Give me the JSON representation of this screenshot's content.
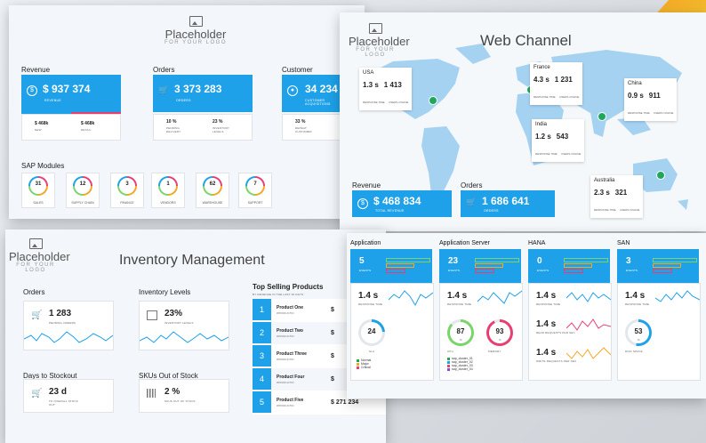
{
  "logo": {
    "name": "Placeholder",
    "sub": "FOR YOUR LOGO"
  },
  "top_left": {
    "sections": {
      "revenue": "Revenue",
      "orders": "Orders",
      "customer": "Customer"
    },
    "revenue": {
      "value": "$ 937 374",
      "caption": "REVENUE",
      "sub1_value": "$ 468k",
      "sub1_label": "NEW",
      "sub2_value": "$ 468k",
      "sub2_label": "RETAIL"
    },
    "orders": {
      "value": "3 373 283",
      "caption": "ORDERS",
      "sub1_value": "10 %",
      "sub1_label": "PENDING DELIVERY",
      "sub2_value": "23 %",
      "sub2_label": "INVENTORY LEVELS"
    },
    "customer": {
      "value": "34 234",
      "caption": "CUSTOMER ACQUISITIONS",
      "sub1_value": "33 %",
      "sub1_label": "REPEAT CUSTOMER"
    },
    "sap_title": "SAP Modules",
    "modules": [
      {
        "value": "31",
        "label": "SALES"
      },
      {
        "value": "12",
        "label": "SUPPLY CHAIN"
      },
      {
        "value": "3",
        "label": "FINANCE"
      },
      {
        "value": "1",
        "label": "VENDORS"
      },
      {
        "value": "62",
        "label": "WAREHOUSE"
      },
      {
        "value": "7",
        "label": "SUPPORT"
      }
    ]
  },
  "web": {
    "title": "Web Channel",
    "response_label": "RESPONSE TIME",
    "users_label": "USERS ONLINE",
    "tips": [
      {
        "country": "USA",
        "time": "1.3 s",
        "users": "1 413"
      },
      {
        "country": "France",
        "time": "4.3 s",
        "users": "1 231"
      },
      {
        "country": "China",
        "time": "0.9 s",
        "users": "911"
      },
      {
        "country": "India",
        "time": "1.2 s",
        "users": "543"
      },
      {
        "country": "Australia",
        "time": "2.3 s",
        "users": "321"
      }
    ],
    "revenue_label": "Revenue",
    "revenue_value": "$ 468 834",
    "revenue_caption": "TOTAL REVENUE",
    "orders_label": "Orders",
    "orders_value": "1 686 641",
    "orders_caption": "ORDERS"
  },
  "inventory": {
    "title": "Inventory Management",
    "orders_label": "Orders",
    "orders_value": "1 283",
    "orders_caption": "PENDING ORDERS",
    "levels_label": "Inventory Levels",
    "levels_value": "23%",
    "levels_caption": "INVENTORY LEVELS",
    "stockout_label": "Days to Stockout",
    "stockout_value": "23 d",
    "stockout_caption": "TO OVERALL STOCK OUT",
    "sku_label": "SKUs Out of Stock",
    "sku_value": "2 %",
    "sku_caption": "SKUS OUT OF STOCK",
    "top_title": "Top Selling Products",
    "top_sub": "BY REVENUE IN THE LAST 30 DAYS",
    "products": [
      {
        "num": "1",
        "name": "Product One",
        "sub": "#PRODUCTID",
        "value": "$"
      },
      {
        "num": "2",
        "name": "Product Two",
        "sub": "#PRODUCTID",
        "value": "$"
      },
      {
        "num": "3",
        "name": "Product Three",
        "sub": "#PRODUCTID",
        "value": "$"
      },
      {
        "num": "4",
        "name": "Product Four",
        "sub": "#PRODUCTID",
        "value": "$"
      },
      {
        "num": "5",
        "name": "Product Five",
        "sub": "#PRODUCTID",
        "value": "$ 271 234"
      }
    ]
  },
  "systems": {
    "columns": [
      {
        "title": "Application",
        "events": "5",
        "time": "1.4 s",
        "time_caption": "RESPONSE TIME"
      },
      {
        "title": "Application Server",
        "events": "23",
        "time": "1.4 s",
        "time_caption": "RESPONSE TIME"
      },
      {
        "title": "HANA",
        "events": "0",
        "time": "1.4 s",
        "time_caption": "RESPONSE TIME"
      },
      {
        "title": "SAN",
        "events": "3",
        "time": "1.4 s",
        "time_caption": "RESPONSE TIME"
      }
    ],
    "events_caption": "EVENTS",
    "app_gauge": {
      "value": "24",
      "caption": "SLA"
    },
    "cpu": {
      "value": "87",
      "unit": "%",
      "caption": "CPU"
    },
    "mem": {
      "value": "93",
      "unit": "%",
      "caption": "MEMORY"
    },
    "hana_read": {
      "value": "1.4 s",
      "caption": "READ REQUESTS PER SEC"
    },
    "hana_write": {
      "value": "1.4 s",
      "caption": "WRITE REQUESTS PER SEC"
    },
    "san_gauge": {
      "value": "53",
      "unit": "%",
      "caption": "DISK SPACE"
    },
    "app_legend": [
      "Normal",
      "Major",
      "Critical"
    ],
    "clusters": [
      "sap_cluster_01",
      "sap_cluster_02",
      "sap_cluster_03",
      "sap_cluster_04"
    ]
  },
  "colors": {
    "accent": "#1ea1e8",
    "green": "#1fa85c",
    "pink": "#e83f73",
    "orange": "#f5a623"
  }
}
